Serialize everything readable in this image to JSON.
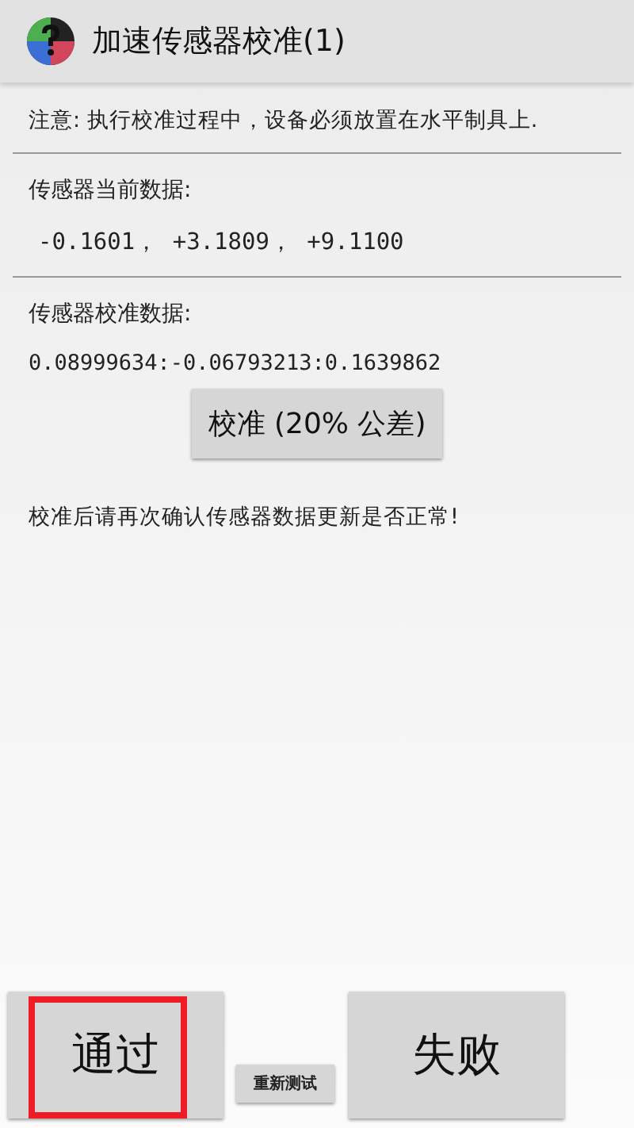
{
  "title_bar": {
    "title": "加速传感器校准(1)"
  },
  "notice": "注意: 执行校准过程中，设备必须放置在水平制具上.",
  "current_data": {
    "label": "传感器当前数据:",
    "value": "-0.1601， +3.1809， +9.1100"
  },
  "calibration_data": {
    "label": "传感器校准数据:",
    "value": "0.08999634:-0.06793213:0.1639862"
  },
  "calibrate_button": "校准 (20% 公差)",
  "hint": "校准后请再次确认传感器数据更新是否正常!",
  "bottom_buttons": [
    {
      "label": "通过",
      "kind": "large",
      "highlighted": true
    },
    {
      "label": "重新测试",
      "kind": "small",
      "highlighted": false
    },
    {
      "label": "失败",
      "kind": "large",
      "highlighted": false
    }
  ]
}
